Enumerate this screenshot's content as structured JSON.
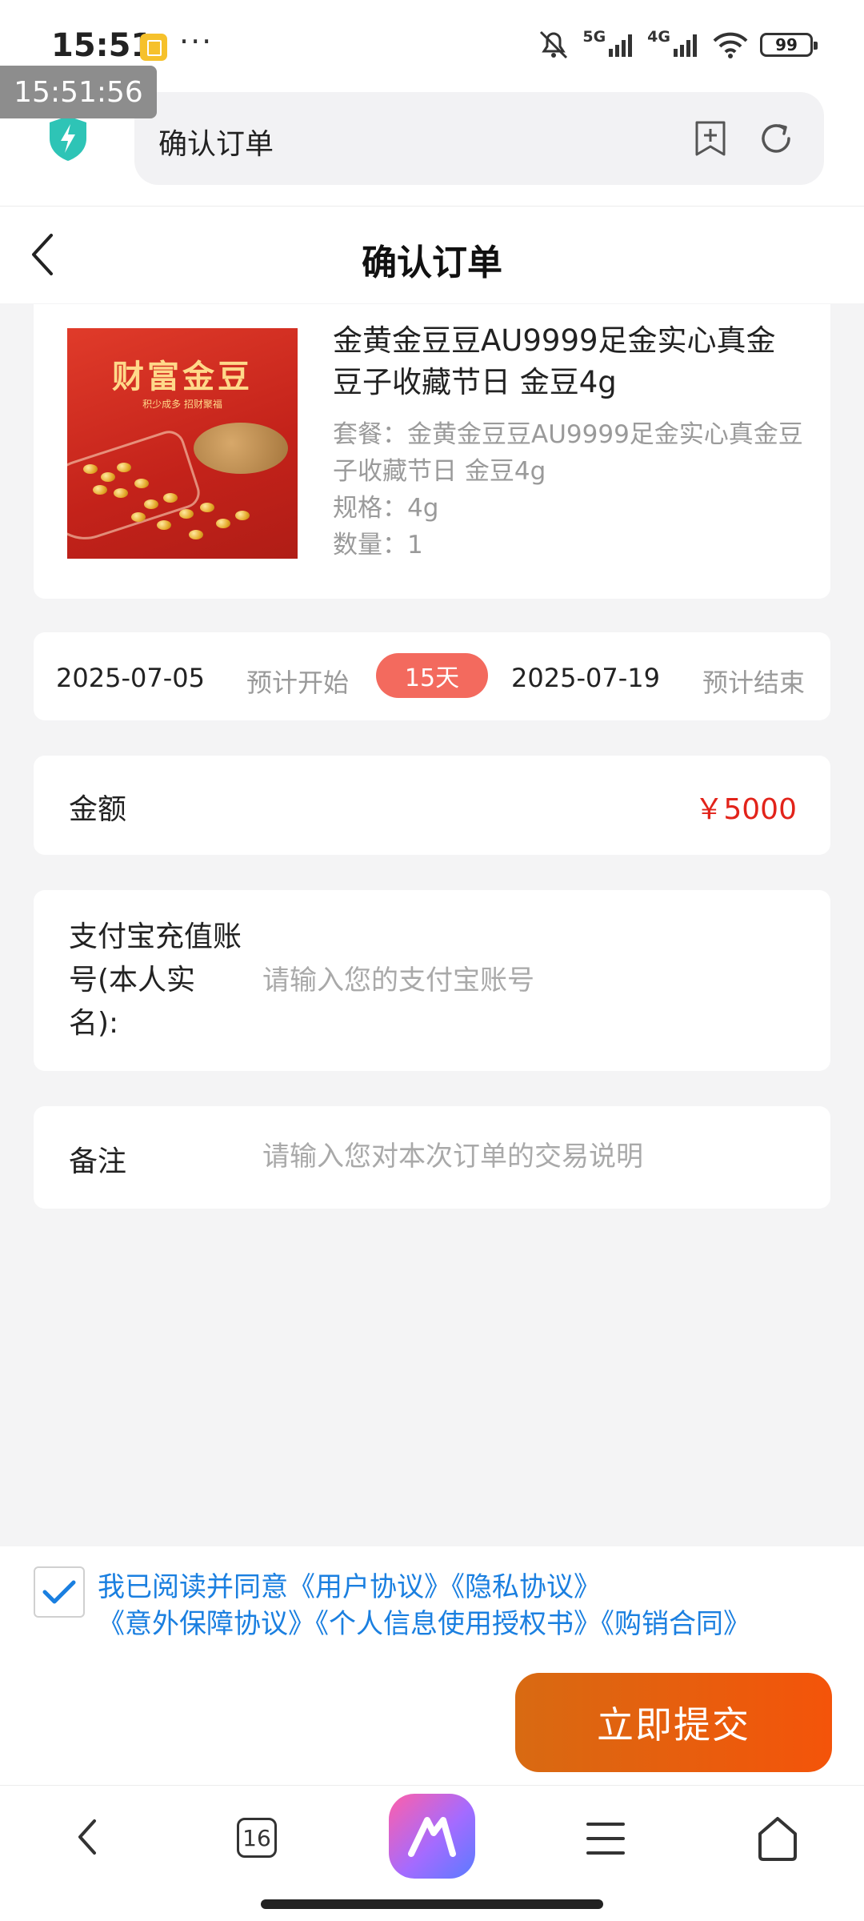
{
  "status_bar": {
    "time": "15:51",
    "more": "···",
    "net1": "5G",
    "net2": "4G",
    "battery": "99"
  },
  "time_overlay": "15:51:56",
  "browser": {
    "url_title": "确认订单",
    "tab_count": "16"
  },
  "page": {
    "title": "确认订单"
  },
  "product": {
    "image_title": "财富金豆",
    "image_subtitle": "积少成多  招财聚福",
    "name": "金黄金豆豆AU9999足金实心真金豆子收藏节日 金豆4g",
    "package": "套餐：金黄金豆豆AU9999足金实心真金豆子收藏节日 金豆4g",
    "spec": "规格：4g",
    "quantity": "数量：1"
  },
  "dates": {
    "start": "2025-07-05",
    "start_label": "预计开始",
    "days": "15天",
    "end": "2025-07-19",
    "end_label": "预计结束"
  },
  "amount": {
    "label": "金额",
    "value": "￥5000",
    "color": "#e2231a"
  },
  "alipay": {
    "label": "支付宝充值账号(本人实名):",
    "value": "",
    "placeholder": "请输入您的支付宝账号"
  },
  "note": {
    "label": "备注",
    "value": "",
    "placeholder": "请输入您对本次订单的交易说明"
  },
  "agreement": {
    "checked": true,
    "prefix": "我已阅读并同意",
    "links": [
      "《用户协议》",
      "《隐私协议》",
      "《意外保障协议》",
      "《个人信息使用授权书》",
      "《购销合同》"
    ],
    "link_color": "#1a7fe0"
  },
  "submit": {
    "label": "立即提交",
    "color": "#f4540a"
  }
}
